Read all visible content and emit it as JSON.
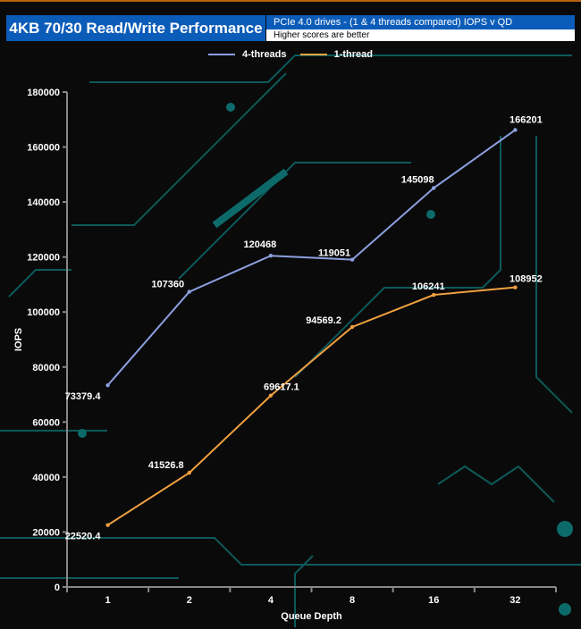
{
  "header": {
    "title": "4KB 70/30 Read/Write Performance",
    "subtitle": "PCIe 4.0 drives - (1 & 4 threads compared) IOPS v QD",
    "note": "Higher scores are better"
  },
  "chart_data": {
    "type": "line",
    "categories": [
      "1",
      "2",
      "4",
      "8",
      "16",
      "32"
    ],
    "xlabel": "Queue Depth",
    "ylabel": "IOPS",
    "ylim": [
      0,
      180000
    ],
    "yticks": [
      0,
      20000,
      40000,
      60000,
      80000,
      100000,
      120000,
      140000,
      160000,
      180000
    ],
    "legend": "top",
    "series": [
      {
        "name": "4-threads",
        "color": "#8ca0e0",
        "values": [
          73379.4,
          107360,
          120468,
          119051,
          145098,
          166201
        ],
        "labels": [
          "73379.4",
          "107360",
          "120468",
          "119051",
          "145098",
          "166201"
        ]
      },
      {
        "name": "1-thread",
        "color": "#f0a040",
        "values": [
          22520.4,
          41526.8,
          69617.1,
          94569.2,
          106241,
          108952
        ],
        "labels": [
          "22520.4",
          "41526.8",
          "69617.1",
          "94569.2",
          "106241",
          "108952"
        ]
      }
    ]
  }
}
